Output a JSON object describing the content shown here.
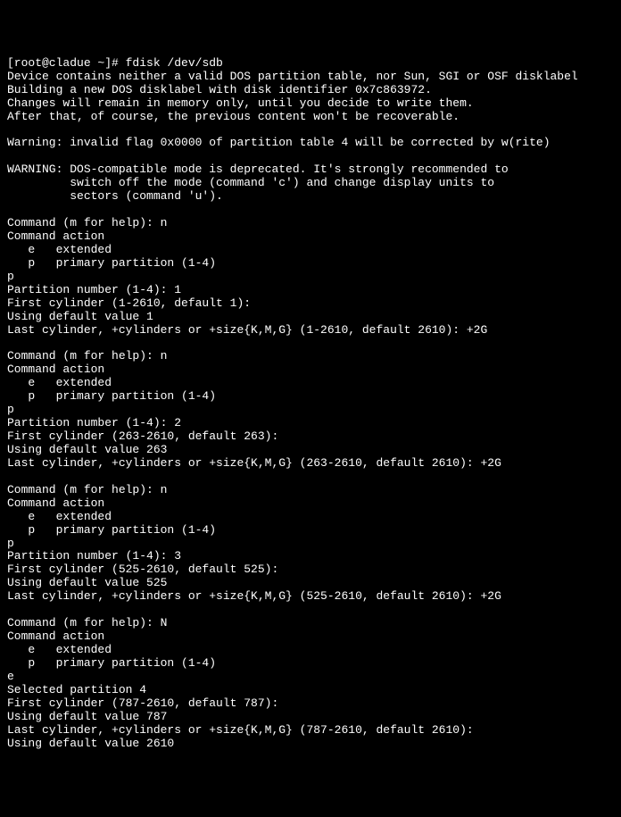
{
  "terminal": {
    "prompt": "[root@cladue ~]# ",
    "command": "fdisk /dev/sdb",
    "output": {
      "line1": "Device contains neither a valid DOS partition table, nor Sun, SGI or OSF disklabel",
      "line2": "Building a new DOS disklabel with disk identifier 0x7c863972.",
      "line3": "Changes will remain in memory only, until you decide to write them.",
      "line4": "After that, of course, the previous content won't be recoverable.",
      "line5": "",
      "line6": "Warning: invalid flag 0x0000 of partition table 4 will be corrected by w(rite)",
      "line7": "",
      "line8": "WARNING: DOS-compatible mode is deprecated. It's strongly recommended to",
      "line9": "         switch off the mode (command 'c') and change display units to",
      "line10": "         sectors (command 'u').",
      "line11": "",
      "line12": "Command (m for help): n",
      "line13": "Command action",
      "line14": "   e   extended",
      "line15": "   p   primary partition (1-4)",
      "line16": "p",
      "line17": "Partition number (1-4): 1",
      "line18": "First cylinder (1-2610, default 1):",
      "line19": "Using default value 1",
      "line20": "Last cylinder, +cylinders or +size{K,M,G} (1-2610, default 2610): +2G",
      "line21": "",
      "line22": "Command (m for help): n",
      "line23": "Command action",
      "line24": "   e   extended",
      "line25": "   p   primary partition (1-4)",
      "line26": "p",
      "line27": "Partition number (1-4): 2",
      "line28": "First cylinder (263-2610, default 263):",
      "line29": "Using default value 263",
      "line30": "Last cylinder, +cylinders or +size{K,M,G} (263-2610, default 2610): +2G",
      "line31": "",
      "line32": "Command (m for help): n",
      "line33": "Command action",
      "line34": "   e   extended",
      "line35": "   p   primary partition (1-4)",
      "line36": "p",
      "line37": "Partition number (1-4): 3",
      "line38": "First cylinder (525-2610, default 525):",
      "line39": "Using default value 525",
      "line40": "Last cylinder, +cylinders or +size{K,M,G} (525-2610, default 2610): +2G",
      "line41": "",
      "line42": "Command (m for help): N",
      "line43": "Command action",
      "line44": "   e   extended",
      "line45": "   p   primary partition (1-4)",
      "line46": "e",
      "line47": "Selected partition 4",
      "line48": "First cylinder (787-2610, default 787):",
      "line49": "Using default value 787",
      "line50": "Last cylinder, +cylinders or +size{K,M,G} (787-2610, default 2610):",
      "line51": "Using default value 2610"
    }
  }
}
